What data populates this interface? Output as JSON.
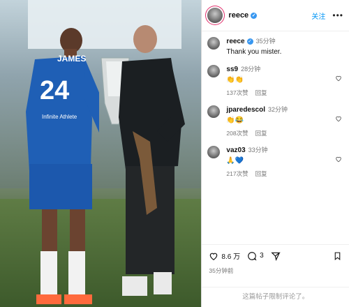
{
  "post": {
    "username": "reece",
    "follow_label": "关注",
    "caption_username": "reece",
    "caption_time": "35分钟",
    "caption_text": "Thank you mister.",
    "likes": "8.6 万",
    "comments_count": "3",
    "posted_ago": "35分钟前",
    "comments_disabled_note": "这篇帖子限制评论了。"
  },
  "photo": {
    "player_name": "JAMES",
    "player_number": "24",
    "sponsor": "Infinite Athlete"
  },
  "comments": [
    {
      "username": "ss9",
      "time": "28分钟",
      "text": "👏👏",
      "likes": "137次赞",
      "reply": "回复"
    },
    {
      "username": "jparedescol",
      "time": "32分钟",
      "text": "👏😂",
      "likes": "208次赞",
      "reply": "回复"
    },
    {
      "username": "vaz03",
      "time": "33分钟",
      "text": "🙏💙",
      "likes": "217次赞",
      "reply": "回复"
    }
  ]
}
